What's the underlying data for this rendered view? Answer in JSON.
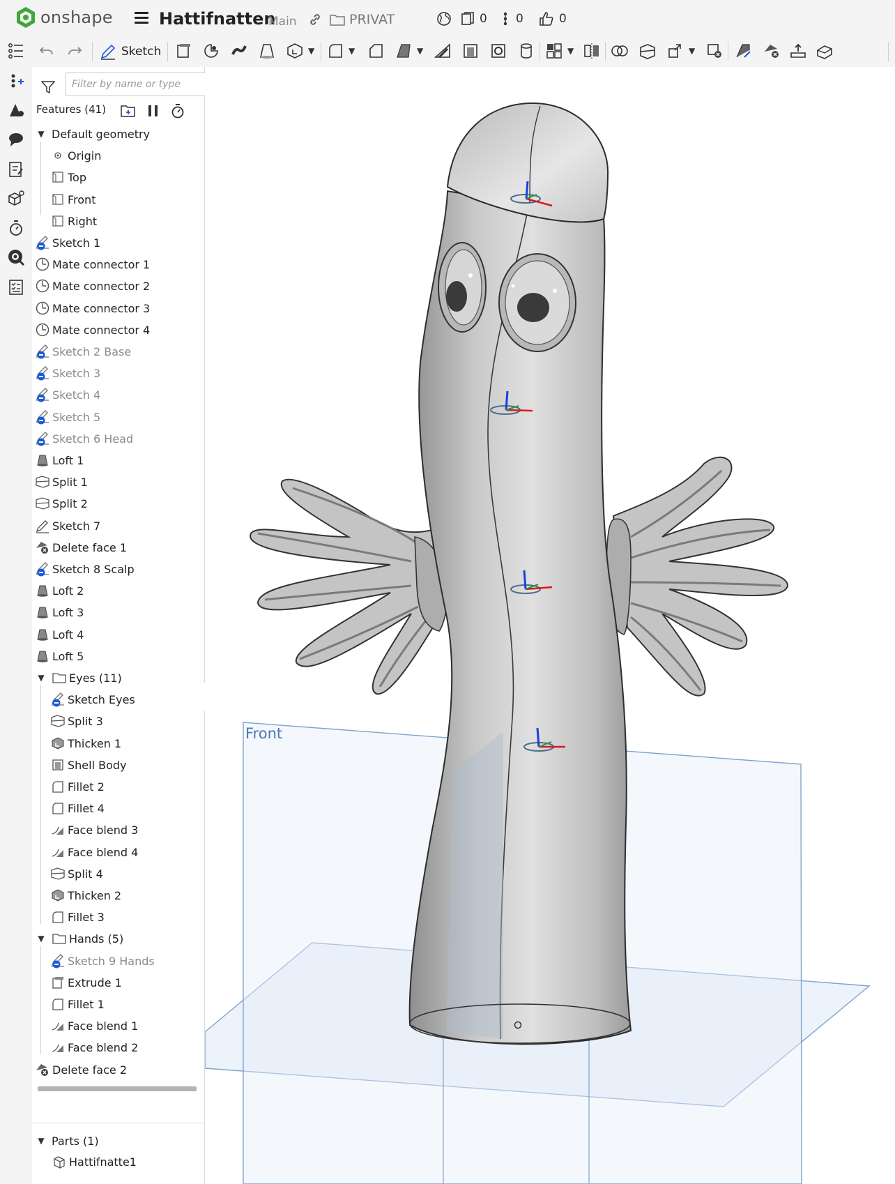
{
  "app": {
    "logo_text": "onshape"
  },
  "document": {
    "title": "Hattifnatten",
    "branch": "Main",
    "folder": "PRIVAT"
  },
  "counters": {
    "versions": "0",
    "branches": "0",
    "likes": "0"
  },
  "toolbar": {
    "sketch_label": "Sketch"
  },
  "filter": {
    "placeholder": "Filter by name or type"
  },
  "features_header": "Features (41)",
  "tree": [
    {
      "label": "Default geometry",
      "icon": "chevron-down-icon",
      "level": 0,
      "dim": false,
      "expand": true
    },
    {
      "label": "Origin",
      "icon": "origin-icon",
      "level": 1,
      "dim": false
    },
    {
      "label": "Top",
      "icon": "plane-icon",
      "level": 1,
      "dim": false
    },
    {
      "label": "Front",
      "icon": "plane-icon",
      "level": 1,
      "dim": false
    },
    {
      "label": "Right",
      "icon": "plane-icon",
      "level": 1,
      "dim": false
    },
    {
      "label": "Sketch 1",
      "icon": "sketch-hidden-icon",
      "level": 0,
      "dim": false
    },
    {
      "label": "Mate connector 1",
      "icon": "mate-connector-icon",
      "level": 0,
      "dim": false
    },
    {
      "label": "Mate connector 2",
      "icon": "mate-connector-icon",
      "level": 0,
      "dim": false
    },
    {
      "label": "Mate connector 3",
      "icon": "mate-connector-icon",
      "level": 0,
      "dim": false
    },
    {
      "label": "Mate connector 4",
      "icon": "mate-connector-icon",
      "level": 0,
      "dim": false
    },
    {
      "label": "Sketch 2 Base",
      "icon": "sketch-hidden-icon",
      "level": 0,
      "dim": true
    },
    {
      "label": "Sketch 3",
      "icon": "sketch-hidden-icon",
      "level": 0,
      "dim": true
    },
    {
      "label": "Sketch 4",
      "icon": "sketch-hidden-icon",
      "level": 0,
      "dim": true
    },
    {
      "label": "Sketch 5",
      "icon": "sketch-hidden-icon",
      "level": 0,
      "dim": true
    },
    {
      "label": "Sketch 6 Head",
      "icon": "sketch-hidden-icon",
      "level": 0,
      "dim": true
    },
    {
      "label": "Loft 1",
      "icon": "loft-icon",
      "level": 0,
      "dim": false
    },
    {
      "label": "Split 1",
      "icon": "split-icon",
      "level": 0,
      "dim": false
    },
    {
      "label": "Split 2",
      "icon": "split-icon",
      "level": 0,
      "dim": false
    },
    {
      "label": "Sketch 7",
      "icon": "sketch-icon",
      "level": 0,
      "dim": false
    },
    {
      "label": "Delete face 1",
      "icon": "delete-face-icon",
      "level": 0,
      "dim": false
    },
    {
      "label": "Sketch 8 Scalp",
      "icon": "sketch-hidden-icon",
      "level": 0,
      "dim": false
    },
    {
      "label": "Loft 2",
      "icon": "loft-icon",
      "level": 0,
      "dim": false
    },
    {
      "label": "Loft 3",
      "icon": "loft-icon",
      "level": 0,
      "dim": false
    },
    {
      "label": "Loft 4",
      "icon": "loft-icon",
      "level": 0,
      "dim": false
    },
    {
      "label": "Loft 5",
      "icon": "loft-icon",
      "level": 0,
      "dim": false
    },
    {
      "label": "Eyes (11)",
      "icon": "folder-icon",
      "level": 0,
      "dim": false,
      "expand": true,
      "folder": true
    },
    {
      "label": "Sketch Eyes",
      "icon": "sketch-hidden-icon",
      "level": 1,
      "dim": false
    },
    {
      "label": "Split 3",
      "icon": "split-icon",
      "level": 1,
      "dim": false
    },
    {
      "label": "Thicken 1",
      "icon": "thicken-icon",
      "level": 1,
      "dim": false
    },
    {
      "label": "Shell Body",
      "icon": "shell-icon",
      "level": 1,
      "dim": false
    },
    {
      "label": "Fillet 2",
      "icon": "fillet-icon",
      "level": 1,
      "dim": false
    },
    {
      "label": "Fillet 4",
      "icon": "fillet-icon",
      "level": 1,
      "dim": false
    },
    {
      "label": "Face blend 3",
      "icon": "face-blend-icon",
      "level": 1,
      "dim": false
    },
    {
      "label": "Face blend 4",
      "icon": "face-blend-icon",
      "level": 1,
      "dim": false
    },
    {
      "label": "Split 4",
      "icon": "split-icon",
      "level": 1,
      "dim": false
    },
    {
      "label": "Thicken 2",
      "icon": "thicken-icon",
      "level": 1,
      "dim": false
    },
    {
      "label": "Fillet 3",
      "icon": "fillet-icon",
      "level": 1,
      "dim": false
    },
    {
      "label": "Hands (5)",
      "icon": "folder-icon",
      "level": 0,
      "dim": false,
      "expand": true,
      "folder": true
    },
    {
      "label": "Sketch 9 Hands",
      "icon": "sketch-hidden-icon",
      "level": 1,
      "dim": true
    },
    {
      "label": "Extrude 1",
      "icon": "extrude-icon",
      "level": 1,
      "dim": false
    },
    {
      "label": "Fillet 1",
      "icon": "fillet-icon",
      "level": 1,
      "dim": false
    },
    {
      "label": "Face blend 1",
      "icon": "face-blend-icon",
      "level": 1,
      "dim": false
    },
    {
      "label": "Face blend 2",
      "icon": "face-blend-icon",
      "level": 1,
      "dim": false
    },
    {
      "label": "Delete face 2",
      "icon": "delete-face-icon",
      "level": 0,
      "dim": false
    }
  ],
  "parts": {
    "header": "Parts (1)",
    "items": [
      "Hattifnatte1"
    ]
  },
  "viewport": {
    "plane_front_label": "Front"
  },
  "colors": {
    "accent_blue": "#1a5bd8",
    "plane_blue": "#4a78b5",
    "logo_green": "#3fa63a"
  }
}
